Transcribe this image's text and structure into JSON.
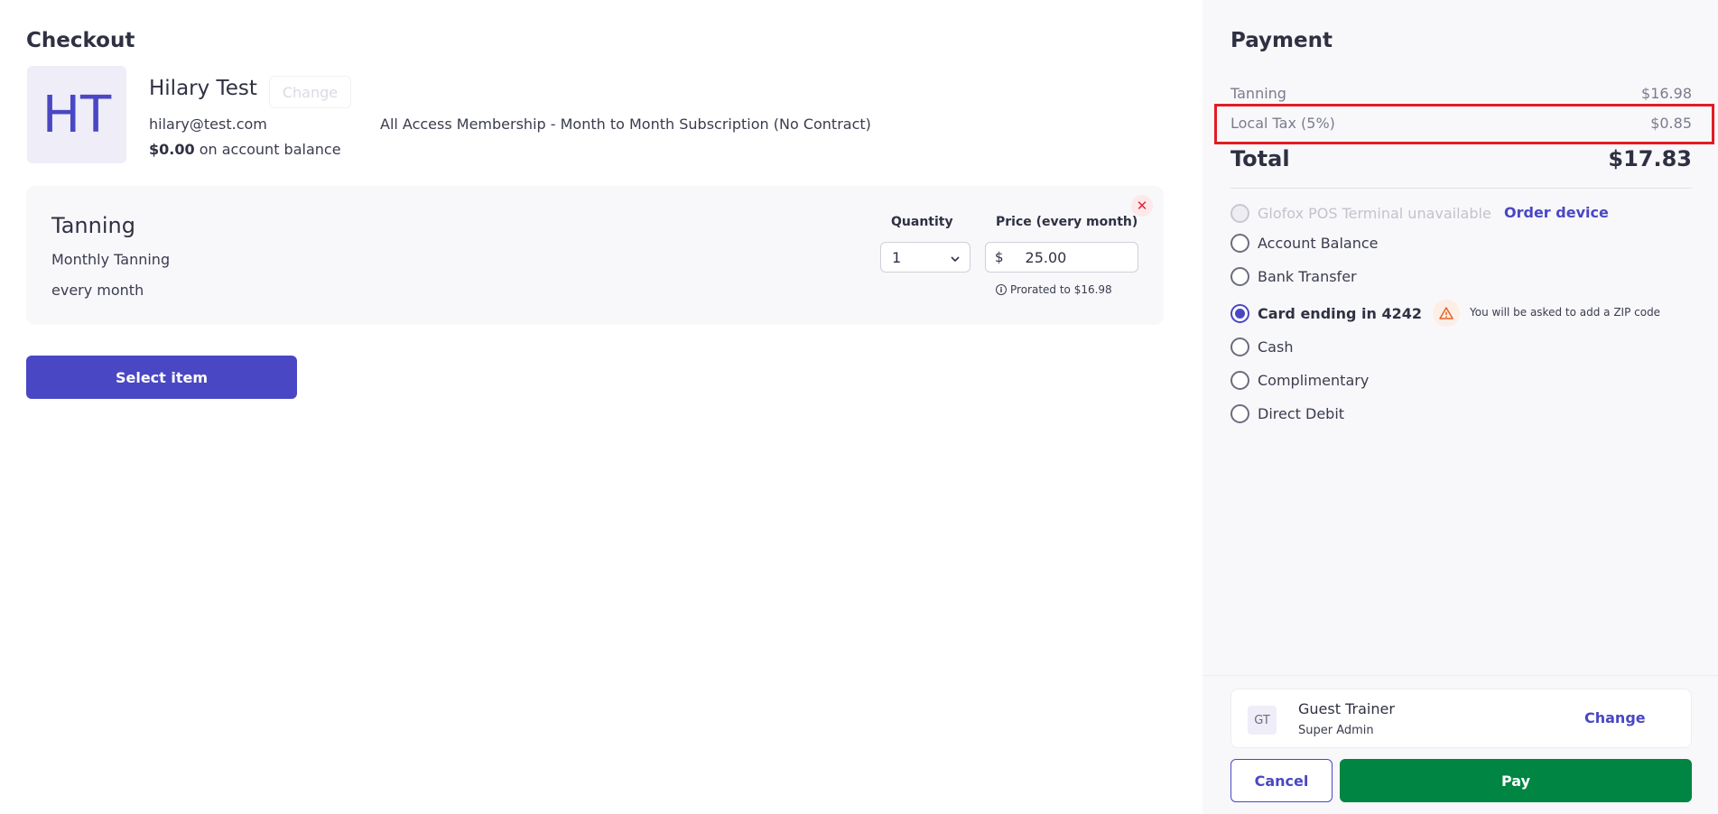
{
  "checkout": {
    "title": "Checkout",
    "member": {
      "initials": "HT",
      "name": "Hilary Test",
      "change_label": "Change",
      "email": "hilary@test.com",
      "membership": "All Access Membership - Month to Month Subscription (No Contract)",
      "balance_amount": "$0.00",
      "balance_suffix": "on account balance"
    },
    "item": {
      "name": "Tanning",
      "description": "Monthly Tanning",
      "frequency": "every month",
      "quantity_label": "Quantity",
      "quantity_value": "1",
      "price_label": "Price (every month)",
      "currency_symbol": "$",
      "price_value": "25.00",
      "prorated": "Prorated to $16.98"
    },
    "select_item_label": "Select item"
  },
  "payment": {
    "title": "Payment",
    "lines": [
      {
        "label": "Tanning",
        "amount": "$16.98"
      },
      {
        "label": "Local Tax (5%)",
        "amount": "$0.85"
      }
    ],
    "total_label": "Total",
    "total_amount": "$17.83",
    "methods": [
      {
        "label": "Glofox POS Terminal unavailable",
        "state": "disabled"
      },
      {
        "label": "Account Balance",
        "state": "unselected"
      },
      {
        "label": "Bank Transfer",
        "state": "unselected"
      },
      {
        "label": "Card ending in 4242",
        "state": "selected"
      },
      {
        "label": "Cash",
        "state": "unselected"
      },
      {
        "label": "Complimentary",
        "state": "unselected"
      },
      {
        "label": "Direct Debit",
        "state": "unselected"
      }
    ],
    "order_device_label": "Order device",
    "zip_warning": "You will be asked to add a ZIP code",
    "staff": {
      "initials": "GT",
      "name": "Guest Trainer",
      "role": "Super Admin",
      "change_label": "Change"
    },
    "cancel_label": "Cancel",
    "pay_label": "Pay"
  },
  "colors": {
    "accent": "#4a47c4",
    "pay_green": "#008542",
    "highlight_red": "#e21c24",
    "remove_red": "#e0243a",
    "warning_orange": "#e4612a"
  },
  "icons": {
    "remove": "close-icon",
    "quantity": "chevron-down-icon",
    "prorated": "info-icon",
    "zip": "warning-icon"
  }
}
